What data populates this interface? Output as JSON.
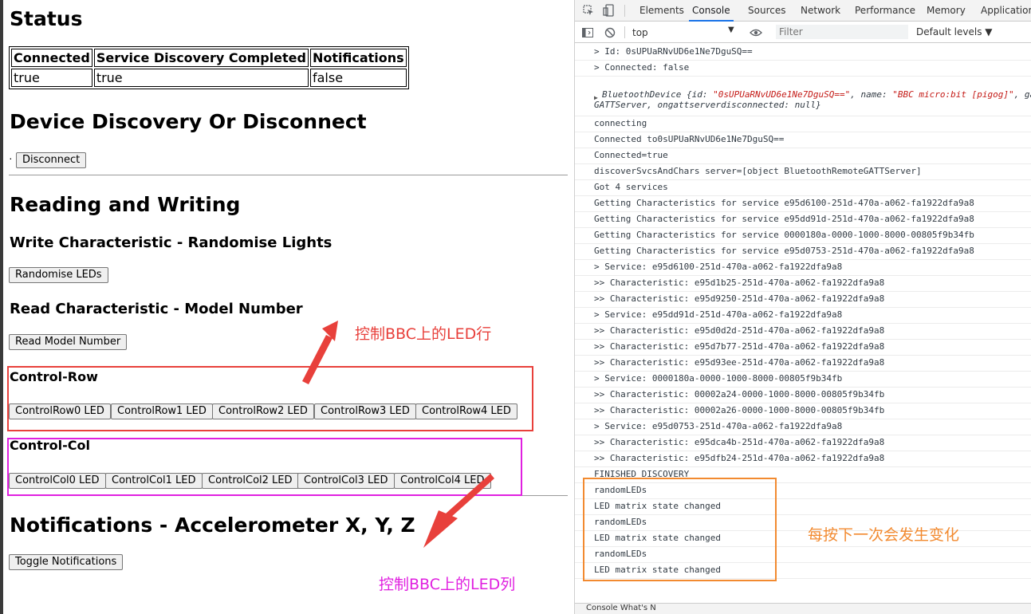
{
  "left": {
    "status_heading": "Status",
    "status_table": {
      "headers": [
        "Connected",
        "Service Discovery Completed",
        "Notifications"
      ],
      "values": [
        "true",
        "true",
        "false"
      ]
    },
    "discovery_heading": "Device Discovery Or Disconnect",
    "discovery_bullet": "·",
    "disconnect_label": "Disconnect",
    "rw_heading": "Reading and Writing",
    "write_heading": "Write Characteristic - Randomise Lights",
    "randomise_label": "Randomise LEDs",
    "read_heading": "Read Characteristic - Model Number",
    "read_model_label": "Read Model Number",
    "row_heading": "Control-Row",
    "row_buttons": [
      "ControlRow0 LED",
      "ControlRow1 LED",
      "ControlRow2 LED",
      "ControlRow3 LED",
      "ControlRow4 LED"
    ],
    "col_heading": "Control-Col",
    "col_buttons": [
      "ControlCol0 LED",
      "ControlCol1 LED",
      "ControlCol2 LED",
      "ControlCol3 LED",
      "ControlCol4 LED"
    ],
    "notif_heading": "Notifications - Accelerometer X, Y, Z",
    "toggle_label": "Toggle Notifications"
  },
  "annotations": {
    "row_note": "控制BBC上的LED行",
    "col_note": "控制BBC上的LED列",
    "console_note": "每按下一次会发生变化",
    "colors": {
      "red": "#e8403b",
      "magenta": "#e020e0",
      "orange": "#f28a30"
    }
  },
  "devtools": {
    "tabs": [
      "Elements",
      "Console",
      "Sources",
      "Network",
      "Performance",
      "Memory",
      "Application"
    ],
    "active_tab": "Console",
    "context": "top",
    "filter_placeholder": "Filter",
    "levels": "Default levels ▼",
    "bottom_text": "Console   What's N",
    "logs": [
      "> Id:   0sUPUaRNvUD6e1Ne7DguSQ==",
      "> Connected: false",
      "",
      "connecting",
      "Connected to0sUPUaRNvUD6e1Ne7DguSQ==",
      "Connected=true",
      "discoverSvcsAndChars server=[object BluetoothRemoteGATTServer]",
      "Got 4 services",
      "Getting Characteristics for service e95d6100-251d-470a-a062-fa1922dfa9a8",
      "Getting Characteristics for service e95dd91d-251d-470a-a062-fa1922dfa9a8",
      "Getting Characteristics for service 0000180a-0000-1000-8000-00805f9b34fb",
      "Getting Characteristics for service e95d0753-251d-470a-a062-fa1922dfa9a8",
      "> Service: e95d6100-251d-470a-a062-fa1922dfa9a8",
      ">> Characteristic: e95d1b25-251d-470a-a062-fa1922dfa9a8",
      ">> Characteristic: e95d9250-251d-470a-a062-fa1922dfa9a8",
      "> Service: e95dd91d-251d-470a-a062-fa1922dfa9a8",
      ">> Characteristic: e95d0d2d-251d-470a-a062-fa1922dfa9a8",
      ">> Characteristic: e95d7b77-251d-470a-a062-fa1922dfa9a8",
      ">> Characteristic: e95d93ee-251d-470a-a062-fa1922dfa9a8",
      "> Service: 0000180a-0000-1000-8000-00805f9b34fb",
      ">> Characteristic: 00002a24-0000-1000-8000-00805f9b34fb",
      ">> Characteristic: 00002a26-0000-1000-8000-00805f9b34fb",
      "> Service: e95d0753-251d-470a-a062-fa1922dfa9a8",
      ">> Characteristic: e95dca4b-251d-470a-a062-fa1922dfa9a8",
      ">> Characteristic: e95dfb24-251d-470a-a062-fa1922dfa9a8",
      "FINISHED DISCOVERY",
      "randomLEDs",
      "LED matrix state changed",
      "randomLEDs",
      "LED matrix state changed",
      "randomLEDs",
      "LED matrix state changed"
    ],
    "object_log": {
      "prefix": "BluetoothDevice {id: ",
      "id_str": "\"0sUPUaRNvUD6e1Ne7DguSQ==\"",
      "mid": ", name: ",
      "name_str": "\"BBC micro:bit [pigog]\"",
      "tail": ", ga",
      "line2": "GATTServer, ongattserverdisconnected: null}"
    }
  }
}
